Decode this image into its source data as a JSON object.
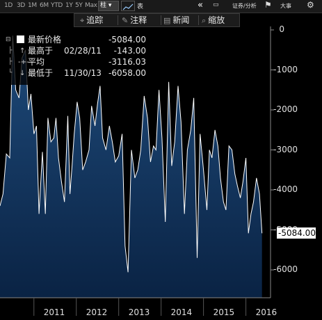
{
  "toolbar": {
    "ranges": [
      "1D",
      "3D",
      "1M",
      "6M",
      "YTD",
      "1Y",
      "5Y",
      "Max"
    ],
    "chart_type_label": "柱",
    "icon_extra": "表",
    "securities_label": "证券/分析",
    "events_label": "大事"
  },
  "annotations": {
    "track_label": "追踪",
    "annotate_label": "注释",
    "news_label": "新闻",
    "zoom_label": "缩放"
  },
  "legend": {
    "last_label": "最新价格",
    "last_value": "-5084.00",
    "high_label": "最高于",
    "high_date": "02/28/11",
    "high_value": "-143.00",
    "avg_label": "平均",
    "avg_value": "-3116.03",
    "low_label": "最低于",
    "low_date": "11/30/13",
    "low_value": "-6058.00"
  },
  "last_value_tag": "-5084.00",
  "colors": {
    "background": "#000000",
    "area_top": "#1e4a7a",
    "area_bottom": "#0a2344",
    "line": "#ffffff"
  },
  "chart_data": {
    "type": "area",
    "xlabel": "",
    "ylabel": "",
    "ylim": [
      -6500,
      0
    ],
    "y_ticks": [
      0,
      -1000,
      -2000,
      -3000,
      -4000,
      -5000,
      -6000
    ],
    "x_ticks": [
      "2011",
      "2012",
      "2013",
      "2014",
      "2015",
      "2016"
    ],
    "x_tick_pos": [
      2011.0,
      2012.0,
      2013.0,
      2014.0,
      2015.0,
      2016.0
    ],
    "xlim": [
      2010.2,
      2016.45
    ],
    "x": [
      2010.2,
      2010.27,
      2010.35,
      2010.43,
      2010.5,
      2010.57,
      2010.65,
      2010.72,
      2010.8,
      2010.87,
      2010.93,
      2011.0,
      2011.06,
      2011.12,
      2011.2,
      2011.27,
      2011.33,
      2011.4,
      2011.47,
      2011.52,
      2011.58,
      2011.65,
      2011.72,
      2011.8,
      2011.85,
      2011.9,
      2011.95,
      2012.02,
      2012.08,
      2012.15,
      2012.22,
      2012.3,
      2012.36,
      2012.44,
      2012.5,
      2012.56,
      2012.62,
      2012.7,
      2012.78,
      2012.85,
      2012.92,
      2013.0,
      2013.08,
      2013.15,
      2013.22,
      2013.3,
      2013.38,
      2013.45,
      2013.52,
      2013.6,
      2013.68,
      2013.75,
      2013.82,
      2013.88,
      2013.95,
      2014.02,
      2014.1,
      2014.18,
      2014.25,
      2014.32,
      2014.4,
      2014.47,
      2014.55,
      2014.62,
      2014.7,
      2014.77,
      2014.85,
      2014.92,
      2015.0,
      2015.08,
      2015.14,
      2015.2,
      2015.27,
      2015.34,
      2015.4,
      2015.47,
      2015.53,
      2015.6,
      2015.67,
      2015.74,
      2015.8,
      2015.87,
      2015.93,
      2016.0,
      2016.06,
      2016.12,
      2016.18,
      2016.25,
      2016.32,
      2016.38
    ],
    "values": [
      -4400,
      -4100,
      -3100,
      -3200,
      -143,
      -1500,
      -1700,
      -700,
      -500,
      -2000,
      -1600,
      -2600,
      -2400,
      -4600,
      -3050,
      -4600,
      -2200,
      -2800,
      -2700,
      -2200,
      -3200,
      -3800,
      -4300,
      -2150,
      -4100,
      -3400,
      -2600,
      -1800,
      -2200,
      -3500,
      -3300,
      -3000,
      -1900,
      -2400,
      -1850,
      -1400,
      -2700,
      -3000,
      -2400,
      -2800,
      -3300,
      -3150,
      -2600,
      -5400,
      -6058,
      -3000,
      -3700,
      -3500,
      -3000,
      -1650,
      -2200,
      -3300,
      -2900,
      -3000,
      -1500,
      -2700,
      -4800,
      -1300,
      -3400,
      -2800,
      -1400,
      -2300,
      -4600,
      -3000,
      -2500,
      -1700,
      -5700,
      -2600,
      -3500,
      -4500,
      -3000,
      -3200,
      -2500,
      -2900,
      -3700,
      -4300,
      -4500,
      -2900,
      -3000,
      -3600,
      -3900,
      -4200,
      -3800,
      -3200,
      -5084,
      -4600,
      -4300,
      -3700,
      -4100,
      -5084
    ]
  }
}
